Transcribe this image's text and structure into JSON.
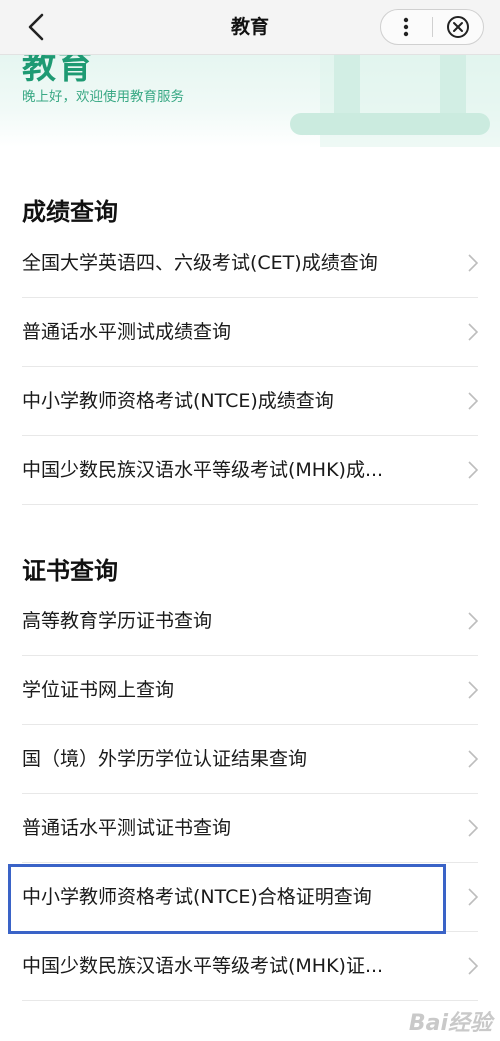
{
  "nav": {
    "title": "教育",
    "back_icon": "chevron-left-icon",
    "more_icon": "more-vertical-icon",
    "close_icon": "close-circle-icon"
  },
  "banner": {
    "big_text": "教育",
    "greeting": "晚上好，欢迎使用教育服务",
    "accent_color": "#1e9a73"
  },
  "sections": [
    {
      "title": "成绩查询",
      "items": [
        {
          "label": "全国大学英语四、六级考试(CET)成绩查询"
        },
        {
          "label": "普通话水平测试成绩查询"
        },
        {
          "label": "中小学教师资格考试(NTCE)成绩查询"
        },
        {
          "label": "中国少数民族汉语水平等级考试(MHK)成..."
        }
      ]
    },
    {
      "title": "证书查询",
      "items": [
        {
          "label": "高等教育学历证书查询"
        },
        {
          "label": "学位证书网上查询"
        },
        {
          "label": "国（境）外学历学位认证结果查询"
        },
        {
          "label": "普通话水平测试证书查询"
        },
        {
          "label": "中小学教师资格考试(NTCE)合格证明查询"
        },
        {
          "label": "中国少数民族汉语水平等级考试(MHK)证..."
        }
      ]
    }
  ],
  "highlight_color": "#3a63c7",
  "watermark": "Bai经验"
}
